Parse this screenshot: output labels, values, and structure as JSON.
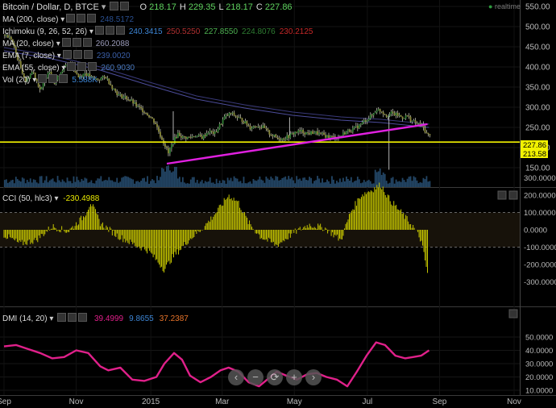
{
  "header": {
    "title": "Bitcoin / Dollar, D, BTCE",
    "ohlc": [
      {
        "label": "O",
        "value": "218.17"
      },
      {
        "label": "H",
        "value": "229.35"
      },
      {
        "label": "L",
        "value": "218.17"
      },
      {
        "label": "C",
        "value": "227.86"
      }
    ],
    "realtime_label": "realtime"
  },
  "indicators": [
    {
      "label": "MA (200, close)",
      "values": [
        "248.5172"
      ],
      "colors": [
        "#2a4f8f"
      ]
    },
    {
      "label": "Ichimoku (9, 26, 52, 26)",
      "values": [
        "240.3415",
        "250.5250",
        "227.8550",
        "224.8076",
        "230.2125"
      ],
      "colors": [
        "#3d86d6",
        "#b03030",
        "#4caf50",
        "#2e7d32",
        "#c62828"
      ]
    },
    {
      "label": "MA (20, close)",
      "values": [
        "260.2088"
      ],
      "colors": [
        "#9a9ab8"
      ]
    },
    {
      "label": "EMA (7, close)",
      "values": [
        "239.0020"
      ],
      "colors": [
        "#3a5fa8"
      ]
    },
    {
      "label": "EMA (55, close)",
      "values": [
        "260.9030"
      ],
      "colors": [
        "#4a7ac0"
      ]
    },
    {
      "label": "Vol (20)",
      "values": [
        "5.588K"
      ],
      "colors": [
        "#3d86d6"
      ]
    }
  ],
  "price_badges": [
    {
      "value": "227.86",
      "bg": "#f2f200",
      "fg": "#000000"
    },
    {
      "value": "213.58",
      "bg": "#f2f200",
      "fg": "#000000"
    }
  ],
  "cci_legend": {
    "label": "CCI (50, hlc3)",
    "value": "-230.4988",
    "color": "#e8e800"
  },
  "dmi_legend": {
    "label": "DMI (14, 20)",
    "values": [
      "39.4999",
      "9.8655",
      "37.2387"
    ],
    "colors": [
      "#e0208a",
      "#3d86d6",
      "#e8742a"
    ]
  },
  "nav_buttons": [
    "‹",
    "−",
    "⟳",
    "+",
    "›"
  ],
  "chart_data": {
    "type": "line",
    "panes": [
      {
        "name": "price",
        "series_type": "candlestick",
        "ylim": [
          140,
          560
        ],
        "yticks": [
          "550.00",
          "500.00",
          "450.00",
          "400.00",
          "350.00",
          "300.00",
          "250.00",
          "200.00",
          "150.00"
        ],
        "x_months": [
          "Sep",
          "Nov",
          "2015",
          "Mar",
          "May",
          "Jul",
          "Sep",
          "Nov"
        ],
        "close_path": [
          {
            "t": 0,
            "v": 480
          },
          {
            "t": 8,
            "v": 470
          },
          {
            "t": 18,
            "v": 410
          },
          {
            "t": 26,
            "v": 365
          },
          {
            "t": 35,
            "v": 390
          },
          {
            "t": 45,
            "v": 340
          },
          {
            "t": 55,
            "v": 395
          },
          {
            "t": 62,
            "v": 360
          },
          {
            "t": 72,
            "v": 395
          },
          {
            "t": 82,
            "v": 410
          },
          {
            "t": 92,
            "v": 375
          },
          {
            "t": 100,
            "v": 385
          },
          {
            "t": 110,
            "v": 370
          },
          {
            "t": 118,
            "v": 370
          },
          {
            "t": 126,
            "v": 375
          },
          {
            "t": 134,
            "v": 350
          },
          {
            "t": 142,
            "v": 330
          },
          {
            "t": 150,
            "v": 325
          },
          {
            "t": 158,
            "v": 315
          },
          {
            "t": 166,
            "v": 300
          },
          {
            "t": 174,
            "v": 290
          },
          {
            "t": 182,
            "v": 275
          },
          {
            "t": 188,
            "v": 260
          },
          {
            "t": 194,
            "v": 230
          },
          {
            "t": 200,
            "v": 205
          },
          {
            "t": 204,
            "v": 185
          },
          {
            "t": 210,
            "v": 215
          },
          {
            "t": 216,
            "v": 235
          },
          {
            "t": 222,
            "v": 225
          },
          {
            "t": 230,
            "v": 225
          },
          {
            "t": 238,
            "v": 230
          },
          {
            "t": 246,
            "v": 225
          },
          {
            "t": 254,
            "v": 240
          },
          {
            "t": 262,
            "v": 235
          },
          {
            "t": 268,
            "v": 255
          },
          {
            "t": 274,
            "v": 275
          },
          {
            "t": 282,
            "v": 285
          },
          {
            "t": 290,
            "v": 275
          },
          {
            "t": 298,
            "v": 265
          },
          {
            "t": 306,
            "v": 250
          },
          {
            "t": 314,
            "v": 255
          },
          {
            "t": 322,
            "v": 250
          },
          {
            "t": 330,
            "v": 235
          },
          {
            "t": 338,
            "v": 225
          },
          {
            "t": 346,
            "v": 222
          },
          {
            "t": 354,
            "v": 228
          },
          {
            "t": 362,
            "v": 238
          },
          {
            "t": 370,
            "v": 240
          },
          {
            "t": 378,
            "v": 235
          },
          {
            "t": 386,
            "v": 238
          },
          {
            "t": 394,
            "v": 233
          },
          {
            "t": 402,
            "v": 228
          },
          {
            "t": 410,
            "v": 225
          },
          {
            "t": 418,
            "v": 228
          },
          {
            "t": 426,
            "v": 240
          },
          {
            "t": 434,
            "v": 245
          },
          {
            "t": 442,
            "v": 255
          },
          {
            "t": 450,
            "v": 268
          },
          {
            "t": 458,
            "v": 280
          },
          {
            "t": 464,
            "v": 295
          },
          {
            "t": 470,
            "v": 290
          },
          {
            "t": 476,
            "v": 280
          },
          {
            "t": 482,
            "v": 285
          },
          {
            "t": 490,
            "v": 280
          },
          {
            "t": 496,
            "v": 275
          },
          {
            "t": 502,
            "v": 278
          },
          {
            "t": 508,
            "v": 265
          },
          {
            "t": 514,
            "v": 260
          },
          {
            "t": 520,
            "v": 255
          },
          {
            "t": 526,
            "v": 235
          },
          {
            "t": 530,
            "v": 228
          }
        ],
        "moving_average": [
          {
            "t": 0,
            "v": 440
          },
          {
            "t": 60,
            "v": 420
          },
          {
            "t": 120,
            "v": 392
          },
          {
            "t": 180,
            "v": 355
          },
          {
            "t": 240,
            "v": 320
          },
          {
            "t": 300,
            "v": 298
          },
          {
            "t": 360,
            "v": 280
          },
          {
            "t": 420,
            "v": 268
          },
          {
            "t": 470,
            "v": 262
          },
          {
            "t": 530,
            "v": 250
          }
        ],
        "support_line": {
          "y": 213.58
        },
        "trendline": [
          {
            "t": 203,
            "v": 160
          },
          {
            "t": 528,
            "v": 258
          }
        ],
        "ma_label_colors": {
          "moving_average": "#2a4f8f"
        }
      },
      {
        "name": "cci",
        "ylim": [
          -320,
          320
        ],
        "yticks": [
          "300.0000",
          "200.0000",
          "100.0000",
          "0.0000",
          "-100.0000",
          "-200.0000",
          "-300.0000"
        ],
        "levels": [
          100,
          -100
        ],
        "points": [
          {
            "t": 0,
            "v": -30
          },
          {
            "t": 20,
            "v": -80
          },
          {
            "t": 40,
            "v": -60
          },
          {
            "t": 60,
            "v": 20
          },
          {
            "t": 80,
            "v": -10
          },
          {
            "t": 100,
            "v": 80
          },
          {
            "t": 108,
            "v": 160
          },
          {
            "t": 120,
            "v": 40
          },
          {
            "t": 140,
            "v": -30
          },
          {
            "t": 160,
            "v": -80
          },
          {
            "t": 180,
            "v": -120
          },
          {
            "t": 200,
            "v": -230
          },
          {
            "t": 210,
            "v": -160
          },
          {
            "t": 230,
            "v": -60
          },
          {
            "t": 250,
            "v": 20
          },
          {
            "t": 268,
            "v": 120
          },
          {
            "t": 280,
            "v": 200
          },
          {
            "t": 292,
            "v": 160
          },
          {
            "t": 305,
            "v": 40
          },
          {
            "t": 320,
            "v": -40
          },
          {
            "t": 340,
            "v": -90
          },
          {
            "t": 360,
            "v": -20
          },
          {
            "t": 380,
            "v": 30
          },
          {
            "t": 400,
            "v": 10
          },
          {
            "t": 420,
            "v": -60
          },
          {
            "t": 432,
            "v": 100
          },
          {
            "t": 445,
            "v": 200
          },
          {
            "t": 458,
            "v": 230
          },
          {
            "t": 470,
            "v": 260
          },
          {
            "t": 480,
            "v": 180
          },
          {
            "t": 495,
            "v": 100
          },
          {
            "t": 510,
            "v": 20
          },
          {
            "t": 520,
            "v": -60
          },
          {
            "t": 528,
            "v": -250
          }
        ]
      },
      {
        "name": "dmi",
        "ylim": [
          8,
          54
        ],
        "yticks": [
          "50.0000",
          "40.0000",
          "30.0000",
          "20.0000",
          "10.0000"
        ],
        "points": [
          {
            "t": 0,
            "v": 43
          },
          {
            "t": 15,
            "v": 44
          },
          {
            "t": 30,
            "v": 41
          },
          {
            "t": 45,
            "v": 38
          },
          {
            "t": 60,
            "v": 34
          },
          {
            "t": 75,
            "v": 35
          },
          {
            "t": 90,
            "v": 40
          },
          {
            "t": 105,
            "v": 38
          },
          {
            "t": 120,
            "v": 28
          },
          {
            "t": 130,
            "v": 25
          },
          {
            "t": 145,
            "v": 27
          },
          {
            "t": 160,
            "v": 18
          },
          {
            "t": 175,
            "v": 17
          },
          {
            "t": 190,
            "v": 20
          },
          {
            "t": 200,
            "v": 30
          },
          {
            "t": 212,
            "v": 38
          },
          {
            "t": 222,
            "v": 33
          },
          {
            "t": 232,
            "v": 21
          },
          {
            "t": 245,
            "v": 16
          },
          {
            "t": 258,
            "v": 20
          },
          {
            "t": 270,
            "v": 25
          },
          {
            "t": 280,
            "v": 27
          },
          {
            "t": 292,
            "v": 24
          },
          {
            "t": 305,
            "v": 16
          },
          {
            "t": 318,
            "v": 13
          },
          {
            "t": 328,
            "v": 18
          },
          {
            "t": 340,
            "v": 24
          },
          {
            "t": 352,
            "v": 21
          },
          {
            "t": 365,
            "v": 18
          },
          {
            "t": 378,
            "v": 22
          },
          {
            "t": 390,
            "v": 23
          },
          {
            "t": 402,
            "v": 20
          },
          {
            "t": 415,
            "v": 18
          },
          {
            "t": 428,
            "v": 13
          },
          {
            "t": 440,
            "v": 24
          },
          {
            "t": 452,
            "v": 36
          },
          {
            "t": 464,
            "v": 46
          },
          {
            "t": 475,
            "v": 44
          },
          {
            "t": 488,
            "v": 36
          },
          {
            "t": 500,
            "v": 34
          },
          {
            "t": 510,
            "v": 35
          },
          {
            "t": 520,
            "v": 36
          },
          {
            "t": 530,
            "v": 40
          }
        ]
      }
    ],
    "series": [
      {
        "name": "MA (200, close)",
        "pane": "price"
      },
      {
        "name": "CCI (50, hlc3)",
        "pane": "cci"
      },
      {
        "name": "DMI (14, 20)",
        "pane": "dmi"
      }
    ],
    "colors": {
      "up_candle": "#2e7d32",
      "down_candle": "#8a8a3a",
      "candle_wick": "#d8d8c8",
      "volume": "#2f5e88",
      "moving_average": "#4c4c9a",
      "support": "#f2f200",
      "trendline": "#e020e0",
      "cci": "#c8c800",
      "dmi": "#e0208a"
    },
    "grid": true,
    "legend_placement": "top-left"
  }
}
